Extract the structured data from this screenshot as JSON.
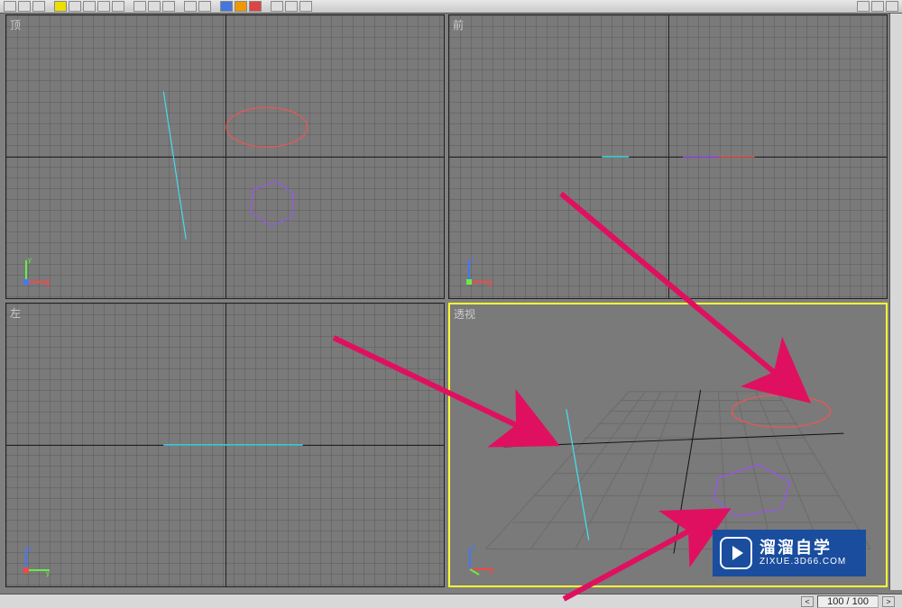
{
  "toolbar": {
    "items": 20
  },
  "viewports": {
    "top": {
      "label": "顶",
      "axis_a": "y",
      "axis_b": "x"
    },
    "front": {
      "label": "前",
      "axis_a": "z",
      "axis_b": "x"
    },
    "left": {
      "label": "左",
      "axis_a": "z",
      "axis_b": "y"
    },
    "persp": {
      "label": "透视",
      "axis_a": "z",
      "axis_b": "x",
      "active": true
    }
  },
  "shapes": {
    "line": {
      "color": "#44ddee"
    },
    "ellipse": {
      "color": "#ee5555"
    },
    "polygon": {
      "color": "#9955ee"
    }
  },
  "gizmo_colors": {
    "x": "#ff4444",
    "y": "#66ee44",
    "z": "#4477ff"
  },
  "annotations": {
    "arrow_color": "#e01060"
  },
  "watermark": {
    "title": "溜溜自学",
    "url": "ZIXUE.3D66.COM"
  },
  "status": {
    "frame": "100 / 100"
  }
}
